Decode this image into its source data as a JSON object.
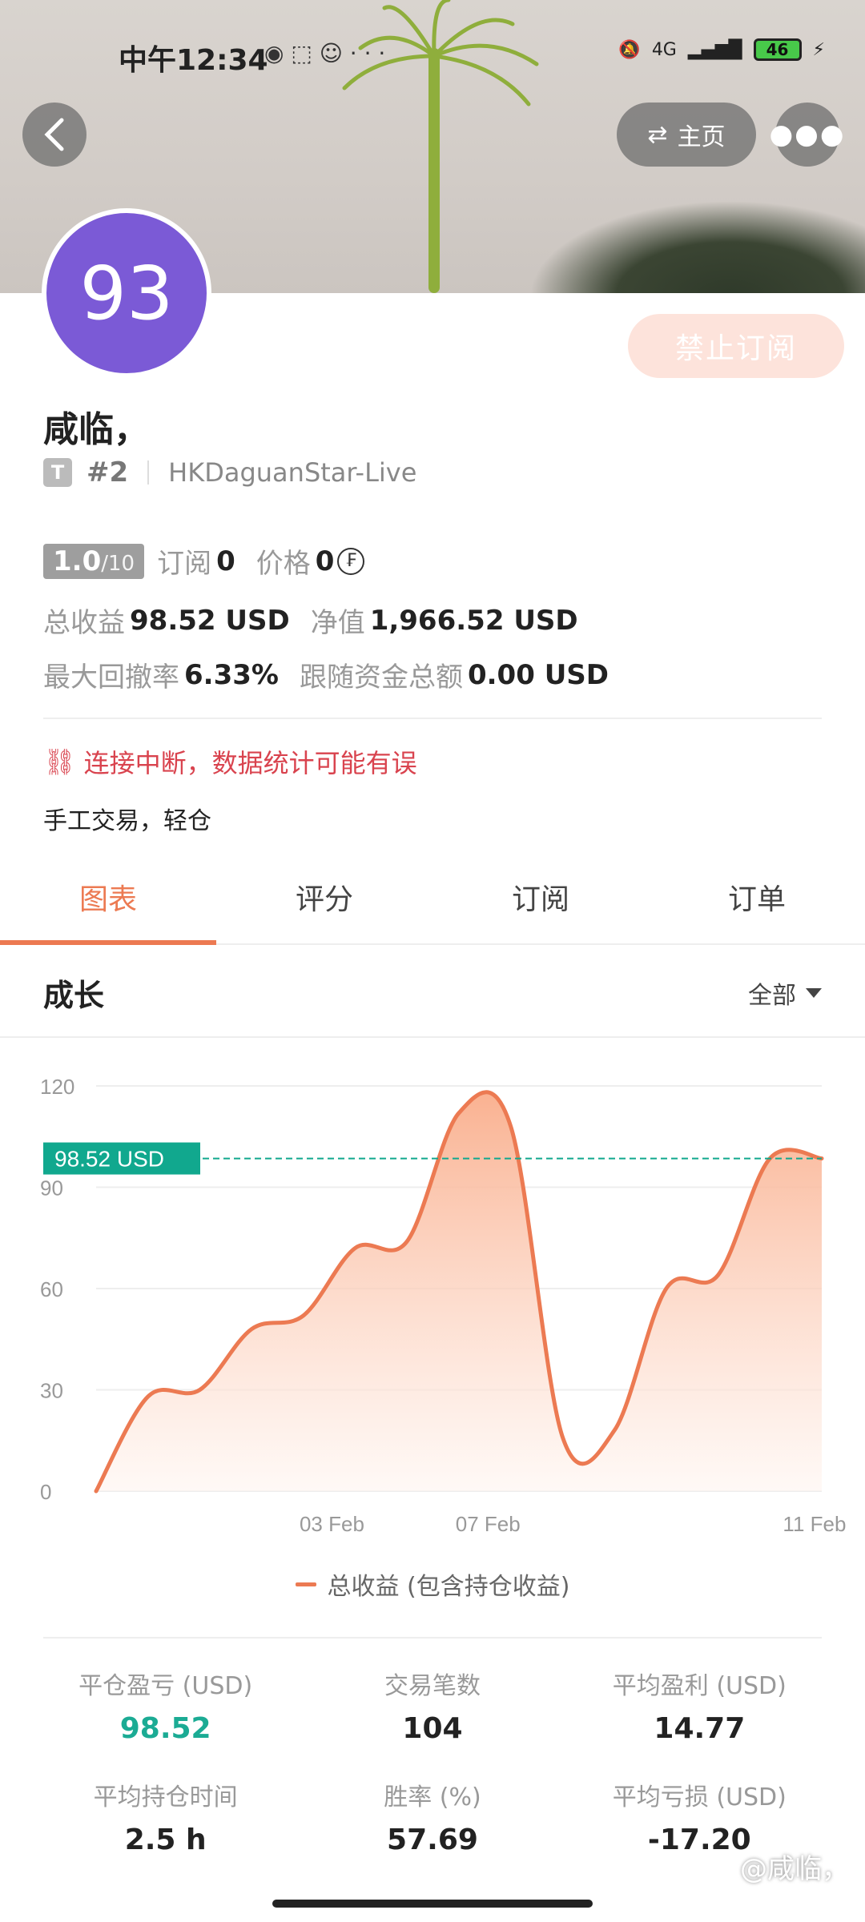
{
  "statusbar": {
    "time": "中午12:34",
    "signal": "4G",
    "battery": "46"
  },
  "header": {
    "home_label": "主页"
  },
  "profile": {
    "avatar_text": "93",
    "ban_button": "禁止订阅",
    "name": "咸临，",
    "badge": "T",
    "rank": "#2",
    "server": "HKDaguanStar-Live",
    "rating": "1.0",
    "rating_max": "/10",
    "subscriptions_label": "订阅",
    "subscriptions_value": "0",
    "price_label": "价格",
    "price_value": "0",
    "total_profit_label": "总收益",
    "total_profit_value": "98.52 USD",
    "net_value_label": "净值",
    "net_value_value": "1,966.52 USD",
    "max_drawdown_label": "最大回撤率",
    "max_drawdown_value": "6.33%",
    "follow_funds_label": "跟随资金总额",
    "follow_funds_value": "0.00 USD",
    "warning": "连接中断，数据统计可能有误",
    "description": "手工交易，轻仓"
  },
  "tabs": [
    {
      "label": "图表",
      "active": true
    },
    {
      "label": "评分",
      "active": false
    },
    {
      "label": "订阅",
      "active": false
    },
    {
      "label": "订单",
      "active": false
    }
  ],
  "section": {
    "title": "成长",
    "filter": "全部"
  },
  "chart_data": {
    "type": "area",
    "y_ticks": [
      "120",
      "90",
      "60",
      "30",
      "0"
    ],
    "x_ticks": [
      "03 Feb",
      "07 Feb",
      "11 Feb"
    ],
    "ylim": [
      0,
      120
    ],
    "current_label": "98.52 USD",
    "current_value": 98.52,
    "series": [
      {
        "name": "总收益 (包含持仓收益)",
        "values": [
          0,
          28,
          30,
          48,
          52,
          72,
          74,
          112,
          108,
          16,
          18,
          60,
          64,
          98.52,
          98.52
        ]
      }
    ],
    "colors": {
      "line": "#ec7a52",
      "fill_top": "#f9a985",
      "fill_bottom": "#fff5f0",
      "current": "#11a88e"
    }
  },
  "legend_label": "总收益 (包含持仓收益)",
  "summary": [
    {
      "label": "平仓盈亏 (USD)",
      "value": "98.52",
      "positive": true
    },
    {
      "label": "交易笔数",
      "value": "104",
      "positive": false
    },
    {
      "label": "平均盈利 (USD)",
      "value": "14.77",
      "positive": false
    },
    {
      "label": "平均持仓时间",
      "value": "2.5 h",
      "positive": false
    },
    {
      "label": "胜率 (%)",
      "value": "57.69",
      "positive": false
    },
    {
      "label": "平均亏损 (USD)",
      "value": "-17.20",
      "positive": false
    }
  ],
  "watermark": "@咸临，"
}
